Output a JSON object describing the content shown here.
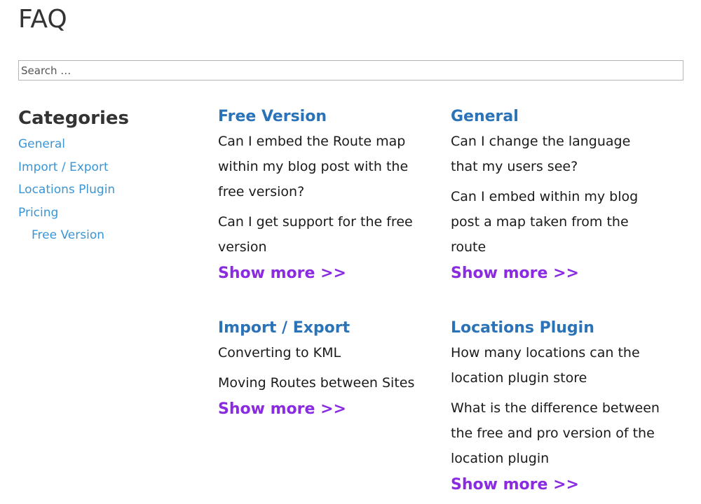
{
  "page": {
    "title": "FAQ"
  },
  "search": {
    "placeholder": "Search …"
  },
  "sidebar": {
    "heading": "Categories",
    "items": [
      {
        "label": "General",
        "sub": false
      },
      {
        "label": "Import / Export",
        "sub": false
      },
      {
        "label": "Locations Plugin",
        "sub": false
      },
      {
        "label": "Pricing",
        "sub": false
      },
      {
        "label": "Free Version",
        "sub": true
      }
    ]
  },
  "sections": [
    {
      "title": "Free Version",
      "questions": [
        "Can I embed the Route map within my blog post with the free version?",
        "Can I get support for the free version"
      ],
      "show_more": "Show more >>"
    },
    {
      "title": "General",
      "questions": [
        "Can I change the language that my users see?",
        "Can I embed within my blog post a map taken from the route"
      ],
      "show_more": "Show more >>"
    },
    {
      "title": "Import / Export",
      "questions": [
        "Converting to KML",
        "Moving Routes between Sites"
      ],
      "show_more": "Show more >>"
    },
    {
      "title": "Locations Plugin",
      "questions": [
        "How many locations can the location plugin store",
        "What is the difference between the free and pro version of the location plugin"
      ],
      "show_more": "Show more >>"
    }
  ],
  "colors": {
    "category_link": "#3a95d4",
    "section_title": "#2a73b8",
    "show_more": "#8a2be2"
  }
}
